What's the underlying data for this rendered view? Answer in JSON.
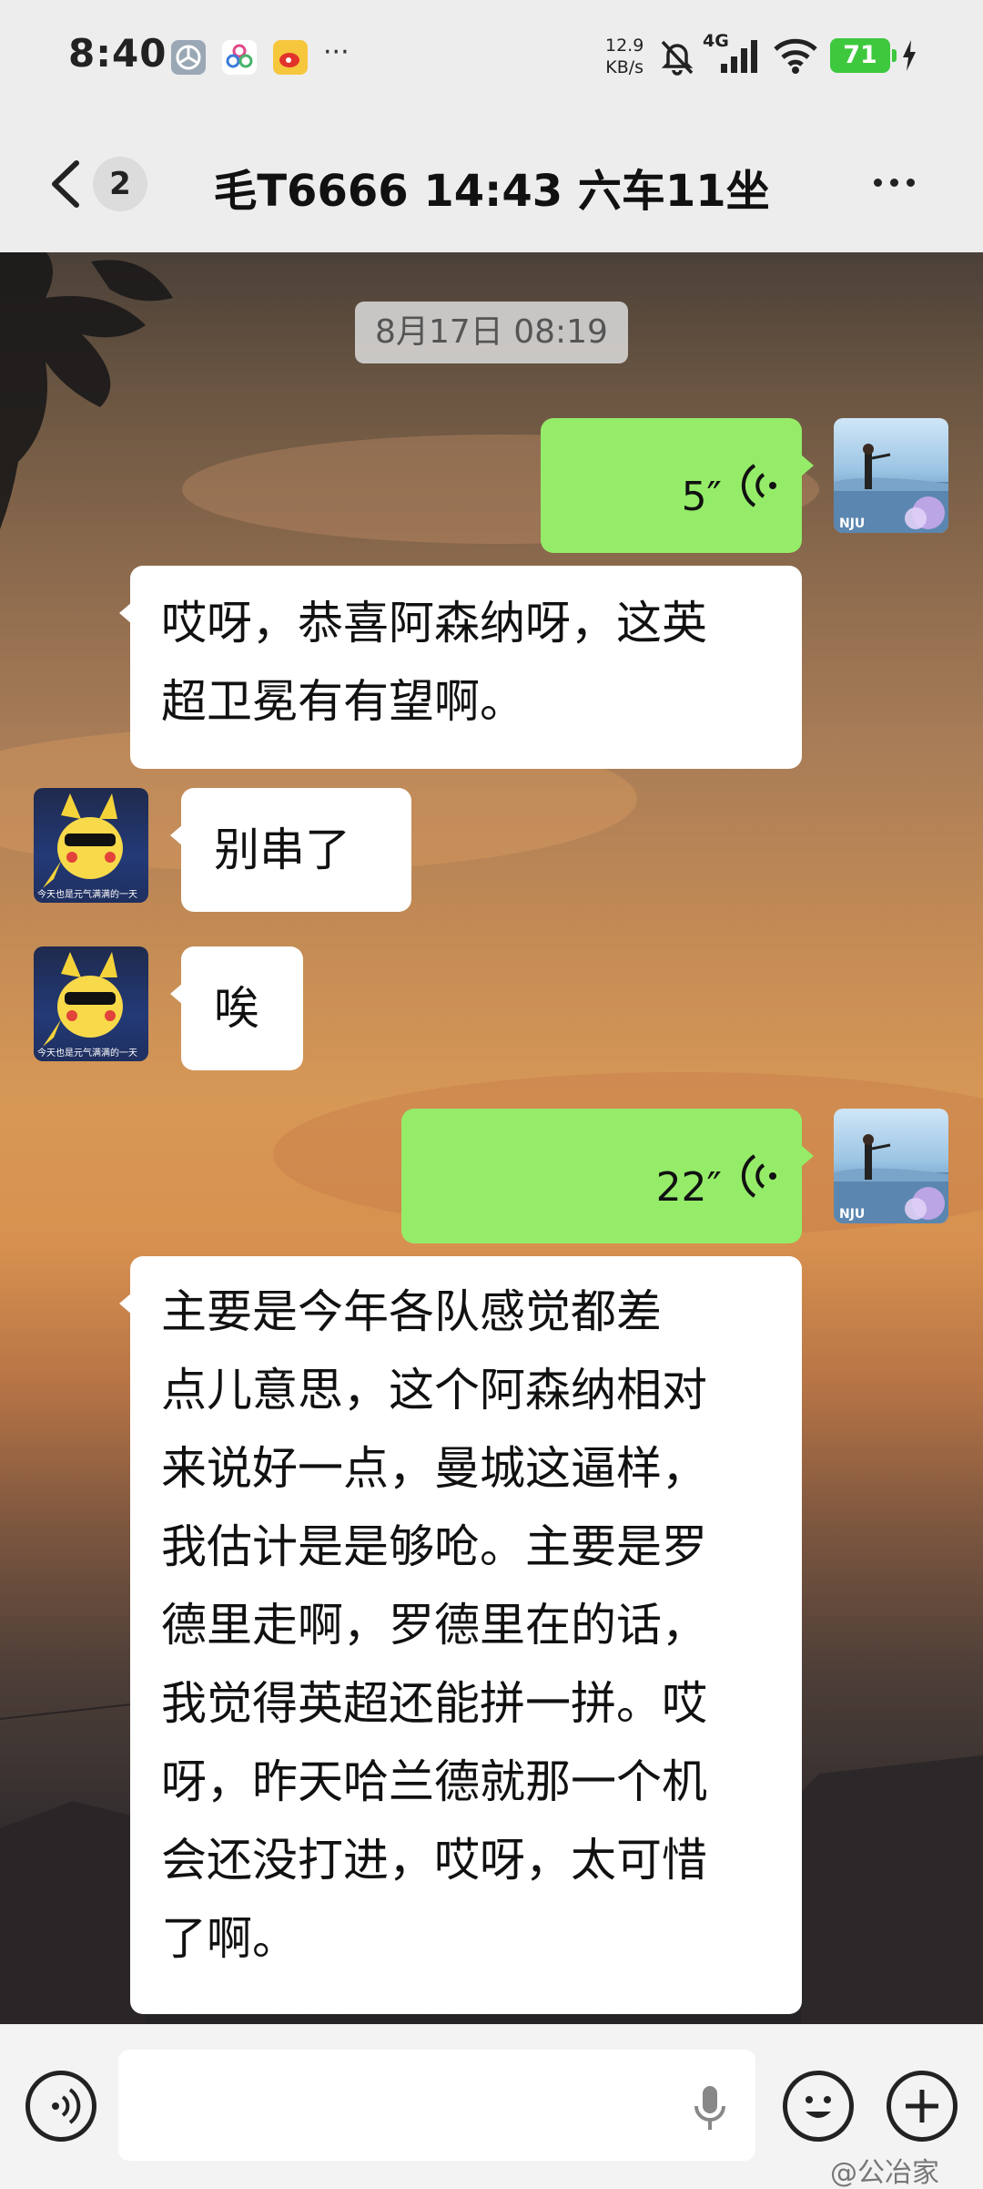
{
  "status_bar": {
    "time": "8:40",
    "more": "···",
    "net_speed_value": "12.9",
    "net_speed_unit": "KB/s",
    "network": "4G",
    "battery": "71"
  },
  "header": {
    "unread_count": "2",
    "title": "毛T6666 14:43 六车11坐"
  },
  "messages": {
    "time_chip": "8月17日 08:19",
    "voice1": {
      "duration": "5″"
    },
    "text1": {
      "lines": [
        "哎呀，恭喜阿森纳呀，这英",
        "超卫冕有有望啊。"
      ]
    },
    "text2": {
      "text": "别串了"
    },
    "text3": {
      "text": "唉"
    },
    "voice2": {
      "duration": "22″"
    },
    "text4": {
      "lines": [
        "主要是今年各队感觉都差",
        "点儿意思，这个阿森纳相对",
        "来说好一点，曼城这逼样，",
        "我估计是是够呛。主要是罗",
        "德里走啊，罗德里在的话，",
        "我觉得英超还能拼一拼。哎",
        "呀，昨天哈兰德就那一个机",
        "会还没打进，哎呀，太可惜",
        "了啊。"
      ]
    }
  },
  "avatars": {
    "self_caption": "NJU",
    "friend_caption": "今天也是元气满满的一天"
  },
  "watermark": "@公冶家",
  "colors": {
    "outgoing_bubble": "#95ec69",
    "incoming_bubble": "#ffffff",
    "battery": "#3dc83d"
  }
}
